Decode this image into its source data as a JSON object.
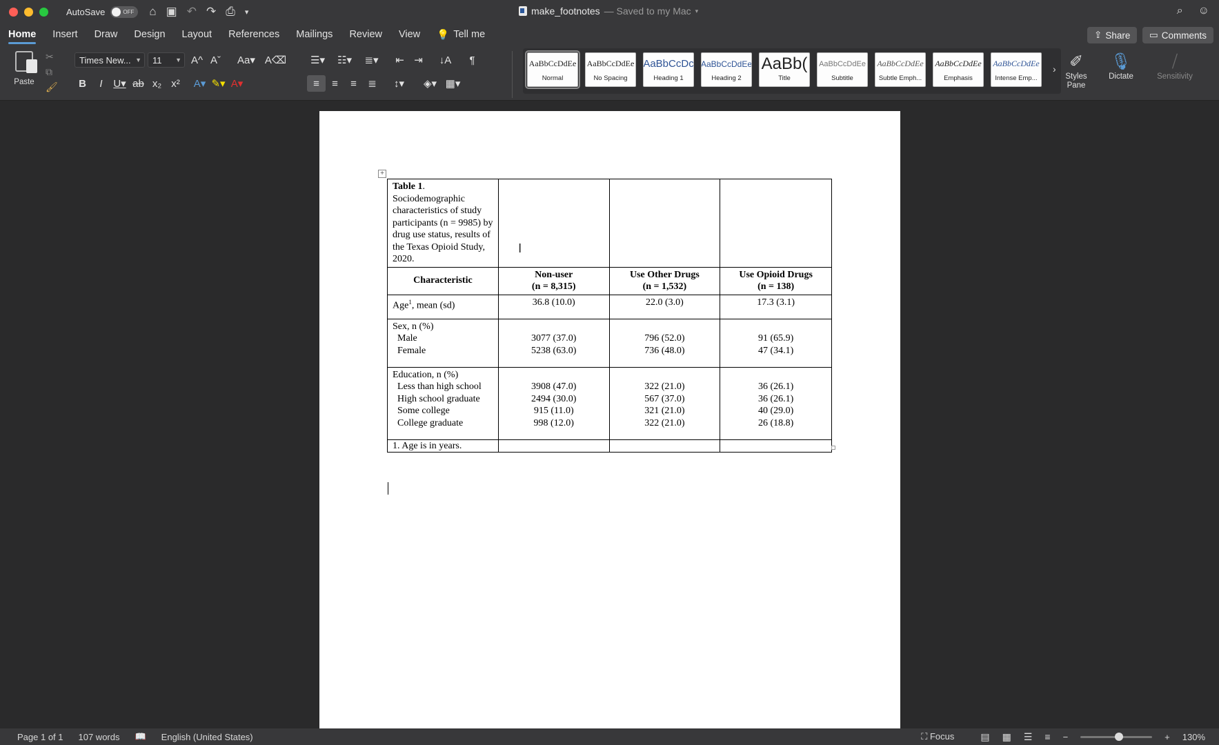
{
  "titlebar": {
    "autosave_label": "AutoSave",
    "autosave_state": "OFF",
    "doc_name": "make_footnotes",
    "saved_status": "— Saved to my Mac"
  },
  "tabs": [
    "Home",
    "Insert",
    "Draw",
    "Design",
    "Layout",
    "References",
    "Mailings",
    "Review",
    "View",
    "Tell me"
  ],
  "share_label": "Share",
  "comments_label": "Comments",
  "ribbon": {
    "paste_label": "Paste",
    "font_name": "Times New...",
    "font_size": "11",
    "styles": [
      {
        "sample": "AaBbCcDdEe",
        "name": "Normal"
      },
      {
        "sample": "AaBbCcDdEe",
        "name": "No Spacing"
      },
      {
        "sample": "AaBbCcDc",
        "name": "Heading 1"
      },
      {
        "sample": "AaBbCcDdEe",
        "name": "Heading 2"
      },
      {
        "sample": "AaBb(",
        "name": "Title"
      },
      {
        "sample": "AaBbCcDdEe",
        "name": "Subtitle"
      },
      {
        "sample": "AaBbCcDdEe",
        "name": "Subtle Emph..."
      },
      {
        "sample": "AaBbCcDdEe",
        "name": "Emphasis"
      },
      {
        "sample": "AaBbCcDdEe",
        "name": "Intense Emp..."
      }
    ],
    "styles_pane_label": "Styles Pane",
    "dictate_label": "Dictate",
    "sensitivity_label": "Sensitivity"
  },
  "table": {
    "caption_bold": "Table 1",
    "caption_text": ". Sociodemographic characteristics of study participants (n = 9985) by drug use status, results of the Texas Opioid Study, 2020.",
    "headers": {
      "characteristic": "Characteristic",
      "col1_name": "Non-user",
      "col1_n": "(n = 8,315)",
      "col2_name": "Use Other Drugs",
      "col2_n": "(n = 1,532)",
      "col3_name": "Use Opioid Drugs",
      "col3_n": "(n = 138)"
    },
    "age": {
      "label": "Age",
      "sup": "1",
      "label_rest": ", mean (sd)",
      "v1": "36.8 (10.0)",
      "v2": "22.0 (3.0)",
      "v3": "17.3 (3.1)"
    },
    "sex": {
      "label": "Sex, n (%)",
      "male": "Male",
      "female": "Female",
      "m1": "3077 (37.0)",
      "m2": "796 (52.0)",
      "m3": "91 (65.9)",
      "f1": "5238 (63.0)",
      "f2": "736 (48.0)",
      "f3": "47 (34.1)"
    },
    "education": {
      "label": "Education, n (%)",
      "rows": [
        {
          "name": "Less than high school",
          "v1": "3908 (47.0)",
          "v2": "322 (21.0)",
          "v3": "36 (26.1)"
        },
        {
          "name": "High school graduate",
          "v1": "2494 (30.0)",
          "v2": "567 (37.0)",
          "v3": "36 (26.1)"
        },
        {
          "name": "Some college",
          "v1": "915 (11.0)",
          "v2": "321 (21.0)",
          "v3": "40 (29.0)"
        },
        {
          "name": "College graduate",
          "v1": "998 (12.0)",
          "v2": "322 (21.0)",
          "v3": "26 (18.8)"
        }
      ]
    },
    "footnote": "1. Age is in years."
  },
  "statusbar": {
    "page": "Page 1 of 1",
    "words": "107 words",
    "language": "English (United States)",
    "focus": "Focus",
    "zoom": "130%"
  }
}
